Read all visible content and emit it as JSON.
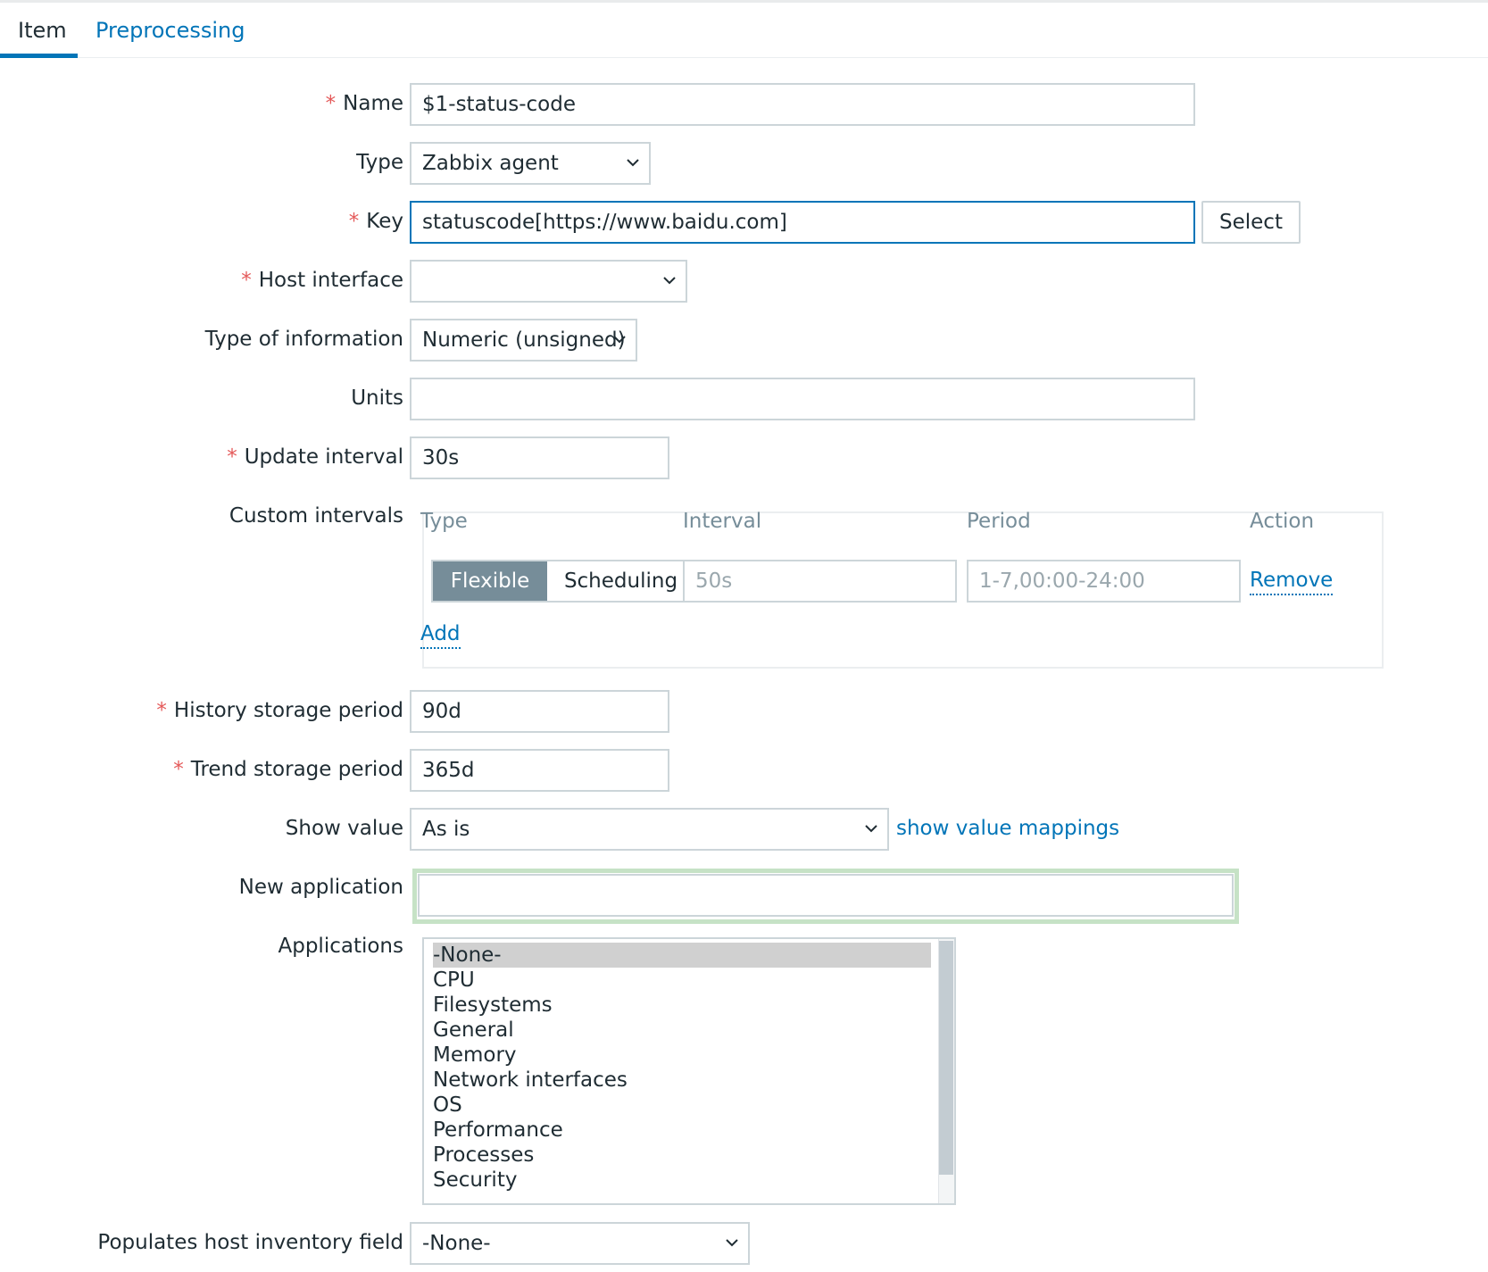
{
  "tabs": {
    "item": "Item",
    "preprocessing": "Preprocessing"
  },
  "form": {
    "name": {
      "label": "Name",
      "value": "$1-status-code"
    },
    "type": {
      "label": "Type",
      "value": "Zabbix agent"
    },
    "key": {
      "label": "Key",
      "value": "statuscode[https://www.baidu.com]",
      "select": "Select"
    },
    "host_interface": {
      "label": "Host interface",
      "value": ""
    },
    "type_of_information": {
      "label": "Type of information",
      "value": "Numeric (unsigned)"
    },
    "units": {
      "label": "Units",
      "value": ""
    },
    "update_interval": {
      "label": "Update interval",
      "value": "30s"
    },
    "custom_intervals": {
      "label": "Custom intervals",
      "headers": {
        "type": "Type",
        "interval": "Interval",
        "period": "Period",
        "action": "Action"
      },
      "row": {
        "flexible": "Flexible",
        "scheduling": "Scheduling",
        "interval_placeholder": "50s",
        "period_placeholder": "1-7,00:00-24:00",
        "remove": "Remove"
      },
      "add": "Add"
    },
    "history": {
      "label": "History storage period",
      "value": "90d"
    },
    "trend": {
      "label": "Trend storage period",
      "value": "365d"
    },
    "show_value": {
      "label": "Show value",
      "value": "As is",
      "link": "show value mappings"
    },
    "new_application": {
      "label": "New application",
      "value": ""
    },
    "applications": {
      "label": "Applications",
      "items": [
        "-None-",
        "CPU",
        "Filesystems",
        "General",
        "Memory",
        "Network interfaces",
        "OS",
        "Performance",
        "Processes",
        "Security"
      ],
      "selected": "-None-"
    },
    "inventory": {
      "label": "Populates host inventory field",
      "value": "-None-"
    }
  },
  "colors": {
    "accent": "#0275b8",
    "required": "#e45959",
    "segment_active": "#768d99"
  }
}
